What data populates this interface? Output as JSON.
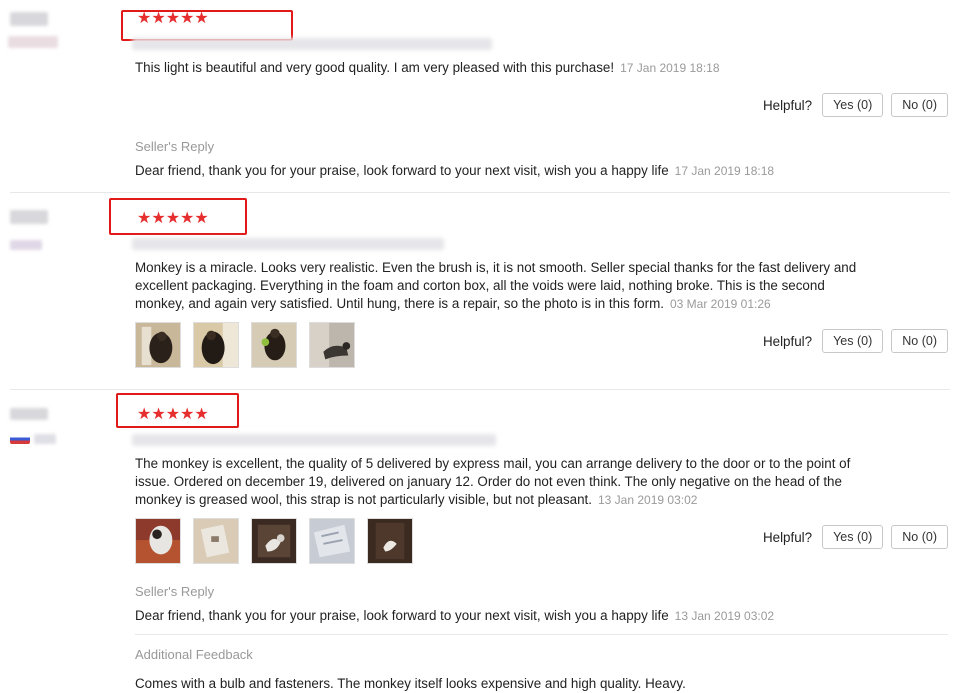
{
  "helpful_label": "Helpful?",
  "stars_glyph": "★★★★★",
  "review1": {
    "rating_stars": 5,
    "text": "This light is beautiful and very good quality. I am very pleased with this purchase!",
    "date": "17 Jan 2019 18:18",
    "yes": "Yes (0)",
    "no": "No (0)",
    "reply_label": "Seller's Reply",
    "reply_text": "Dear friend, thank you for your praise, look forward to your next visit, wish you a happy life",
    "reply_date": "17 Jan 2019 18:18"
  },
  "review2": {
    "rating_stars": 5,
    "text": "Monkey is a miracle. Looks very realistic. Even the brush is, it is not smooth. Seller special thanks for the fast delivery and excellent packaging. Everything in the foam and corton box, all the voids were laid, nothing broke. This is the second monkey, and again very satisfied. Until hung, there is a repair, so the photo is in this form.",
    "date": "03 Mar 2019 01:26",
    "yes": "Yes (0)",
    "no": "No (0)",
    "photos": 4
  },
  "review3": {
    "rating_stars": 5,
    "text": "The monkey is excellent, the quality of 5 delivered by express mail, you can arrange delivery to the door or to the point of issue. Ordered on december 19, delivered on january 12. Order do not even think. The only negative on the head of the monkey is greased wool, this strap is not particularly visible, but not pleasant.",
    "date": "13 Jan 2019 03:02",
    "yes": "Yes (0)",
    "no": "No (0)",
    "photos": 5,
    "reply_label": "Seller's Reply",
    "reply_text": "Dear friend, thank you for your praise, look forward to your next visit, wish you a happy life",
    "reply_date": "13 Jan 2019 03:02",
    "additional_label": "Additional Feedback",
    "additional_text": "Comes with a bulb and fasteners. The monkey itself looks expensive and high quality. Heavy."
  },
  "colors": {
    "star": "#e62e2e",
    "highlight": "#e01919",
    "muted": "#999999"
  }
}
